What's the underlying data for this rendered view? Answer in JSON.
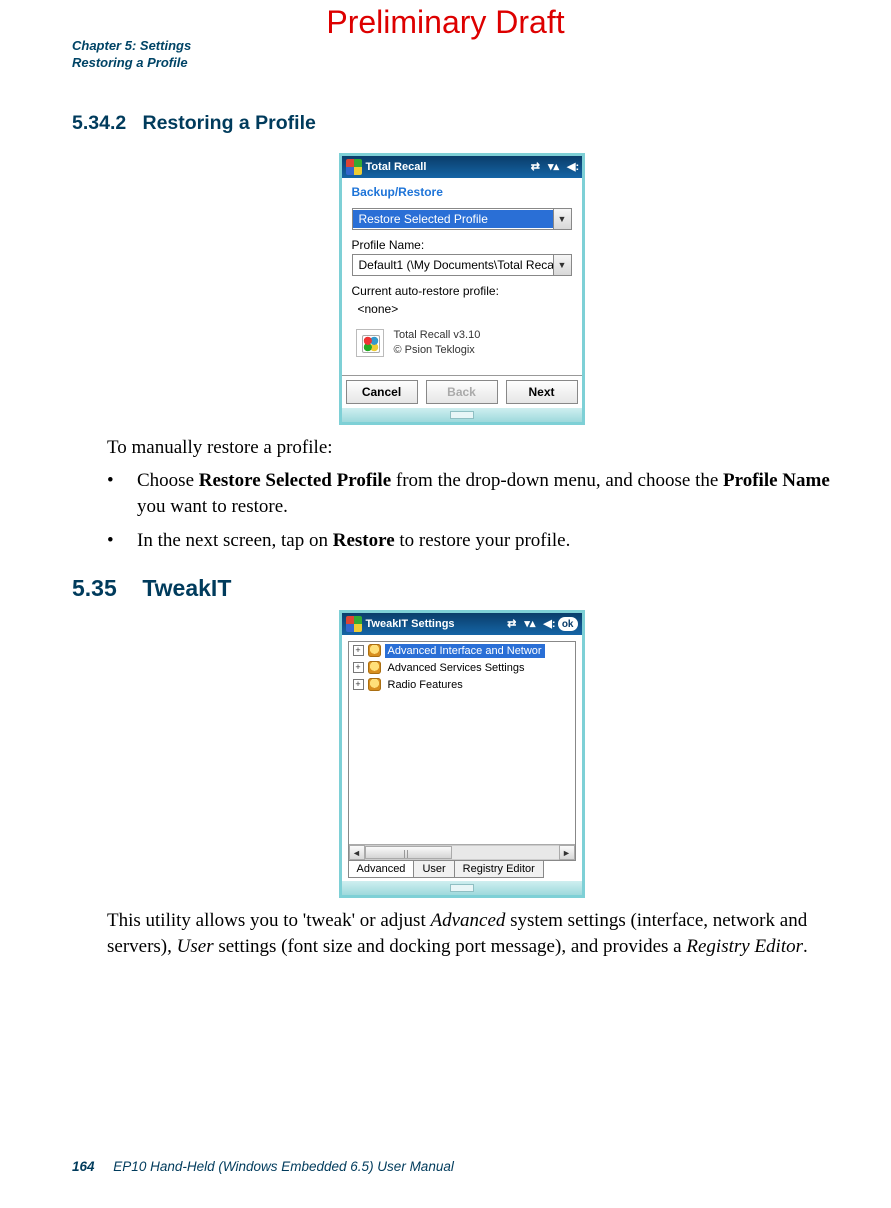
{
  "watermark": "Preliminary Draft",
  "header": {
    "chapter": "Chapter 5: Settings",
    "section": "Restoring a Profile"
  },
  "section1": {
    "number": "5.34.2",
    "title": "Restoring a Profile"
  },
  "device1": {
    "title": "Total Recall",
    "section_label": "Backup/Restore",
    "action_selected": "Restore Selected Profile",
    "profile_label": "Profile Name:",
    "profile_value": "Default1 (\\My Documents\\Total Recal",
    "auto_label": "Current auto-restore profile:",
    "auto_value": "<none>",
    "info_line1": "Total Recall v3.10",
    "info_line2": "© Psion Teklogix",
    "btn_cancel": "Cancel",
    "btn_back": "Back",
    "btn_next": "Next"
  },
  "para1": "To manually restore a profile:",
  "bullet1_a": "Choose ",
  "bullet1_b": "Restore Selected Profile",
  "bullet1_c": " from the drop-down menu, and choose the ",
  "bullet1_d": "Profile Name",
  "bullet1_e": " you want to restore.",
  "bullet2_a": "In the next screen, tap on ",
  "bullet2_b": "Restore",
  "bullet2_c": " to restore your profile.",
  "section2": {
    "number": "5.35",
    "title": "TweakIT"
  },
  "device2": {
    "title": "TweakIT Settings",
    "ok": "ok",
    "items": [
      "Advanced Interface and Networ",
      "Advanced Services Settings",
      "Radio Features"
    ],
    "tabs": [
      "Advanced",
      "User",
      "Registry Editor"
    ]
  },
  "para2_a": "This utility allows you to 'tweak' or adjust ",
  "para2_b": "Advanced",
  "para2_c": " system settings (interface, network and servers), ",
  "para2_d": "User",
  "para2_e": " settings (font size and docking port message), and provides a ",
  "para2_f": "Registry Editor",
  "para2_g": ".",
  "footer": {
    "page": "164",
    "title": "EP10 Hand-Held (Windows Embedded 6.5) User Manual"
  }
}
